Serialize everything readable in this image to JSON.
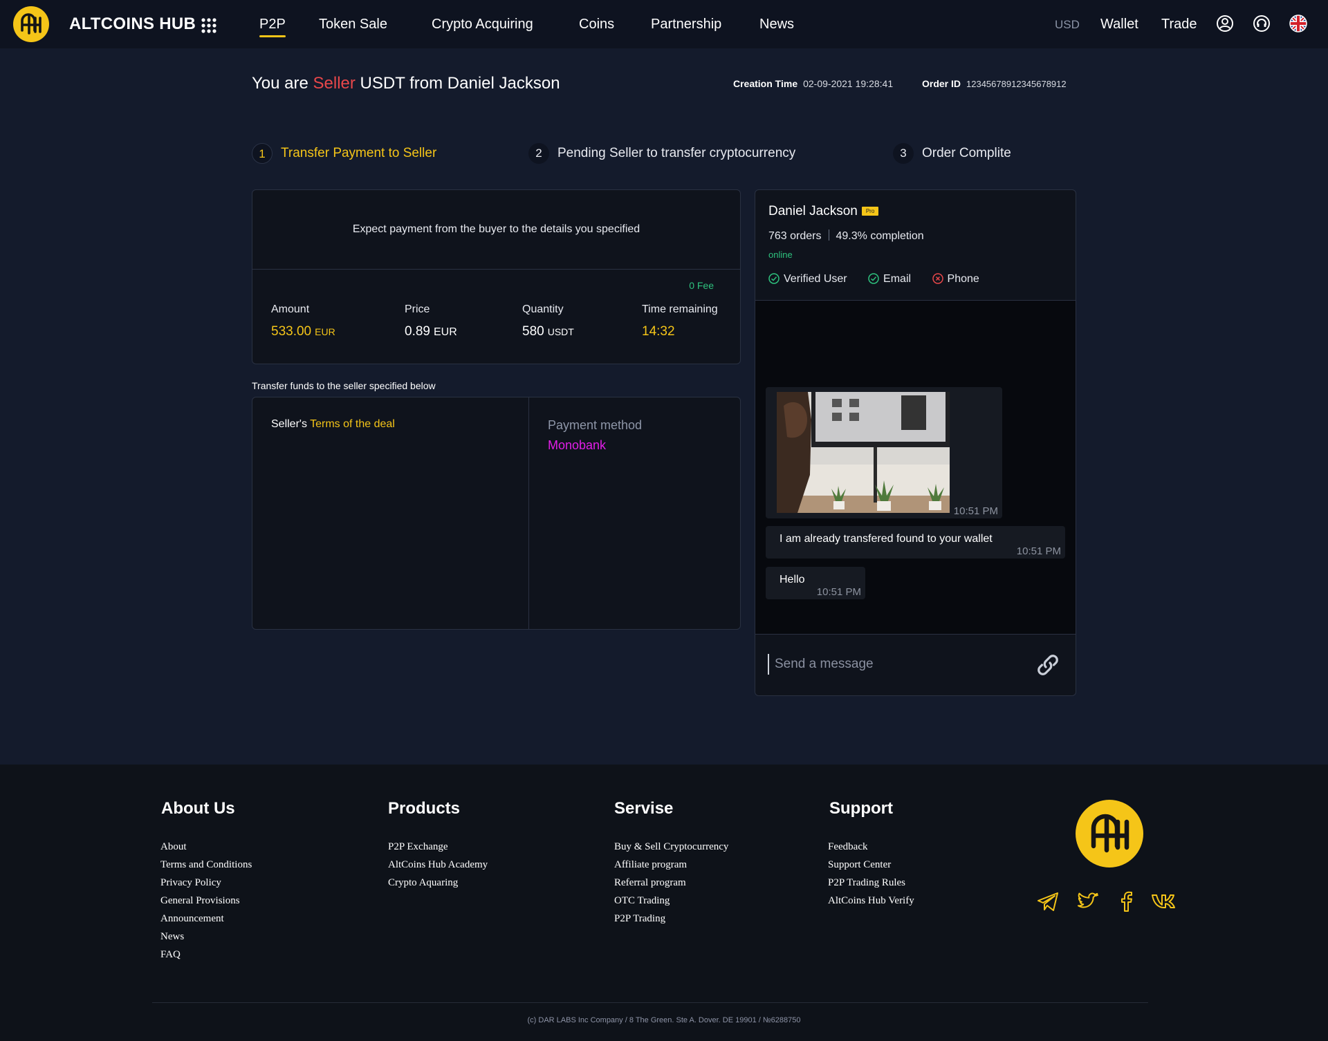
{
  "nav": {
    "brand": "ALTCOINS HUB",
    "links": [
      "P2P",
      "Token Sale",
      "Crypto Acquiring",
      "Coins",
      "Partnership",
      "News"
    ],
    "currency": "USD",
    "wallet": "Wallet",
    "trade": "Trade"
  },
  "order": {
    "title_pre": "You are ",
    "role": "Seller",
    "title_post": " USDT from Daniel Jackson",
    "creation_label": "Creation Time",
    "creation_value": "02-09-2021 19:28:41",
    "id_label": "Order ID",
    "id_value": "12345678912345678912"
  },
  "steps": [
    {
      "num": "1",
      "label": "Transfer Payment to Seller"
    },
    {
      "num": "2",
      "label": "Pending Seller to transfer cryptocurrency"
    },
    {
      "num": "3",
      "label": "Order Complite"
    }
  ],
  "payment": {
    "expect_text": "Expect payment from the buyer to the details you specified",
    "fee": "0 Fee",
    "amount_label": "Amount",
    "amount_value": "533.00",
    "amount_unit": "EUR",
    "price_label": "Price",
    "price_value": "0.89",
    "price_unit": "EUR",
    "quantity_label": "Quantity",
    "quantity_value": "580",
    "quantity_unit": "USDT",
    "time_label": "Time remaining",
    "time_value": "14:32"
  },
  "transfer": {
    "caption": "Transfer funds to the seller specified below",
    "terms_pre": "Seller's ",
    "terms_link": "Terms of the deal",
    "pm_label": "Payment method",
    "pm_value": "Monobank"
  },
  "seller": {
    "name": "Daniel Jackson",
    "badge": "Pro",
    "orders": "763 orders",
    "completion": "49.3% completion",
    "status": "online",
    "verifications": [
      {
        "label": "Verified User",
        "state": "ok"
      },
      {
        "label": "Email",
        "state": "ok"
      },
      {
        "label": "Phone",
        "state": "fail"
      }
    ]
  },
  "chat": {
    "messages": [
      {
        "type": "image",
        "time": "10:51 PM"
      },
      {
        "type": "text",
        "text": "I am already transfered found to your wallet",
        "time": "10:51 PM"
      },
      {
        "type": "text",
        "text": "Hello",
        "time": "10:51 PM"
      }
    ],
    "placeholder": "Send a message"
  },
  "footer": {
    "columns": [
      {
        "title": "About Us",
        "items": [
          "About",
          "Terms and Conditions",
          "Privacy Policy",
          "General Provisions",
          "Announcement",
          "News",
          "FAQ"
        ]
      },
      {
        "title": "Products",
        "items": [
          "P2P Exchange",
          "AltCoins Hub Academy",
          "Crypto Aquaring"
        ]
      },
      {
        "title": "Servise",
        "items": [
          "Buy & Sell Cryptocurrency",
          "Affiliate program",
          "Referral program",
          "OTC Trading",
          "P2P Trading"
        ]
      },
      {
        "title": "Support",
        "items": [
          "Feedback",
          "Support Center",
          "P2P Trading Rules",
          "AltCoins Hub Verify"
        ]
      }
    ],
    "social": [
      "telegram-icon",
      "twitter-icon",
      "facebook-icon",
      "vk-icon"
    ],
    "copyright": "(c) DAR LABS Inc Company / 8 The Green. Ste A. Dover. DE 19901 / №6288750"
  },
  "colors": {
    "accent": "#f5c518",
    "seller_role": "#e8474a",
    "online": "#2ec27e",
    "payment_method": "#e21ee8",
    "background": "#141b2c"
  }
}
